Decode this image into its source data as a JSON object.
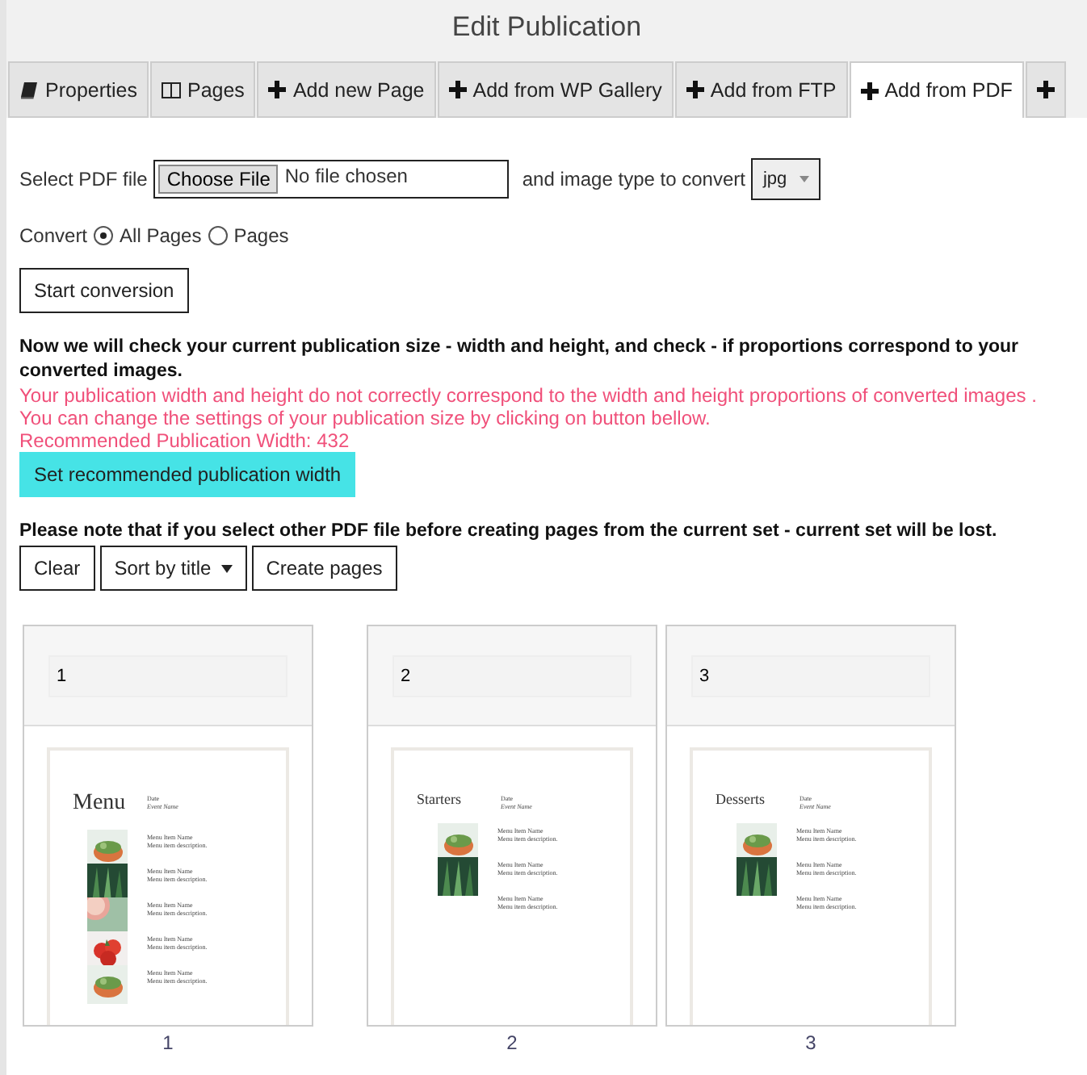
{
  "window": {
    "title": "Edit Publication"
  },
  "tabs": [
    {
      "label": "Properties",
      "kind": "book",
      "selected": false
    },
    {
      "label": "Pages",
      "kind": "columns",
      "selected": false
    },
    {
      "label": "Add new Page",
      "kind": "plus",
      "selected": false
    },
    {
      "label": "Add from WP Gallery",
      "kind": "plus",
      "selected": false
    },
    {
      "label": "Add from FTP",
      "kind": "plus",
      "selected": false
    },
    {
      "label": "Add from PDF",
      "kind": "plus",
      "selected": true
    },
    {
      "kind": "plus",
      "selected": false
    }
  ],
  "file_row": {
    "label": "Select PDF file",
    "button": "Choose File",
    "status": "No file chosen",
    "type_label": "and image type to convert",
    "image_type": "jpg"
  },
  "convert": {
    "label": "Convert",
    "options": [
      {
        "label": "All Pages",
        "selected": true
      },
      {
        "label": "Pages",
        "selected": false
      }
    ]
  },
  "start_button": "Start conversion",
  "check_notice": "Now we will check your current publication size - width and height, and check - if proportions correspond to your converted images.",
  "warning": "Your publication width and height do not correctly correspond to the width and height proportions of converted images . You can change the settings of your publication size by clicking on button bellow.",
  "recommended": "Recommended Publication Width: 432",
  "recommend_button": "Set recommended publication width",
  "lose_notice": "Please note that if you select other PDF file before creating pages from the current set - current set will be lost.",
  "actions": [
    {
      "label": "Clear",
      "kind": "button"
    },
    {
      "label": "Sort by title",
      "kind": "dropdown"
    },
    {
      "label": "Create pages",
      "kind": "button"
    }
  ],
  "pages": [
    {
      "title_field": "1",
      "heading": "Menu",
      "date": "Date",
      "event": "Event Name",
      "caption": "1",
      "items": [
        {
          "name": "Menu Item Name",
          "description": "Menu item description.",
          "kind": "picture"
        },
        {
          "name": "Menu Item Name",
          "description": "Menu item description.",
          "kind": "picture"
        },
        {
          "name": "Menu Item Name",
          "description": "Menu item description.",
          "kind": "picture"
        },
        {
          "name": "Menu Item Name",
          "description": "Menu item description.",
          "kind": "picture"
        },
        {
          "name": "Menu Item Name",
          "description": "Menu item description.",
          "kind": "picture"
        }
      ]
    },
    {
      "title_field": "2",
      "heading": "Starters",
      "date": "Date",
      "event": "Event Name",
      "caption": "2",
      "items": [
        {
          "name": "Menu Item Name",
          "description": "Menu item description.",
          "kind": "picture"
        },
        {
          "name": "Menu Item Name",
          "description": "Menu item description.",
          "kind": "picture"
        },
        {
          "name": "Menu Item Name",
          "description": "Menu item description.",
          "kind": "text"
        }
      ]
    },
    {
      "title_field": "3",
      "heading": "Desserts",
      "date": "Date",
      "event": "Event Name",
      "caption": "3",
      "items": [
        {
          "name": "Menu Item Name",
          "description": "Menu item description.",
          "kind": "picture"
        },
        {
          "name": "Menu Item Name",
          "description": "Menu item description.",
          "kind": "picture"
        },
        {
          "name": "Menu Item Name",
          "description": "Menu item description.",
          "kind": "text"
        }
      ]
    }
  ]
}
